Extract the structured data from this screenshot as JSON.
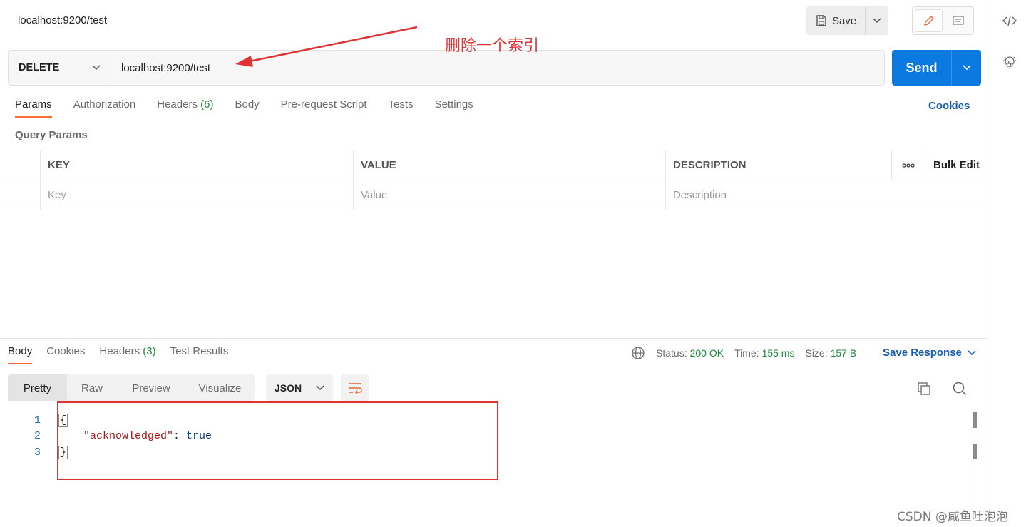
{
  "header": {
    "title": "localhost:9200/test",
    "save_label": "Save"
  },
  "request": {
    "method": "DELETE",
    "url": "localhost:9200/test",
    "send_label": "Send"
  },
  "annotation": {
    "text": "删除一个索引",
    "color": "#e03434"
  },
  "request_tabs": [
    {
      "label": "Params",
      "count": ""
    },
    {
      "label": "Authorization",
      "count": ""
    },
    {
      "label": "Headers",
      "count": "(6)"
    },
    {
      "label": "Body",
      "count": ""
    },
    {
      "label": "Pre-request Script",
      "count": ""
    },
    {
      "label": "Tests",
      "count": ""
    },
    {
      "label": "Settings",
      "count": ""
    }
  ],
  "cookies_label": "Cookies",
  "query_params": {
    "label": "Query Params",
    "columns": [
      "KEY",
      "VALUE",
      "DESCRIPTION"
    ],
    "more_icon": "ellipsis-icon",
    "bulk_edit_label": "Bulk Edit",
    "placeholders": {
      "key": "Key",
      "value": "Value",
      "description": "Description"
    }
  },
  "response": {
    "tabs": [
      {
        "label": "Body",
        "count": ""
      },
      {
        "label": "Cookies",
        "count": ""
      },
      {
        "label": "Headers",
        "count": "(3)"
      },
      {
        "label": "Test Results",
        "count": ""
      }
    ],
    "status_label": "Status:",
    "status_value": "200 OK",
    "time_label": "Time:",
    "time_value": "155 ms",
    "size_label": "Size:",
    "size_value": "157 B",
    "save_response_label": "Save Response",
    "views": [
      "Pretty",
      "Raw",
      "Preview",
      "Visualize"
    ],
    "format": "JSON",
    "code_lines": [
      {
        "num": "1",
        "text": "{"
      },
      {
        "num": "2",
        "key": "\"acknowledged\"",
        "sep": ": ",
        "value": "true"
      },
      {
        "num": "3",
        "text": "}"
      }
    ]
  },
  "colors": {
    "accent": "#ff6c37",
    "send": "#0b7ae0",
    "link": "#1a5cb0",
    "success": "#1b8a3a"
  },
  "watermark": "CSDN @咸鱼吐泡泡"
}
